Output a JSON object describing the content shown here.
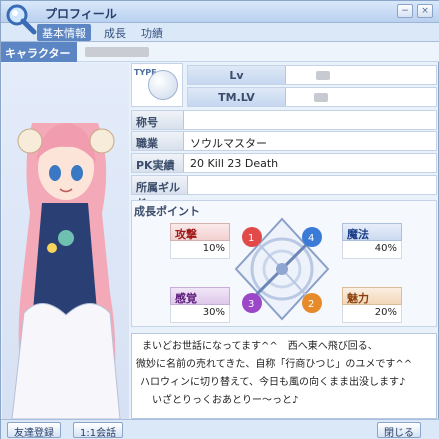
{
  "window": {
    "title": "プロフィール",
    "min_label": "−",
    "close_label": "×"
  },
  "tabs": [
    {
      "label": "基本情報",
      "active": true
    },
    {
      "label": "成長",
      "active": false
    },
    {
      "label": "功績",
      "active": false
    }
  ],
  "character": {
    "name_label": "キャラクター名"
  },
  "type": {
    "label": "TYPE"
  },
  "level": {
    "lv_label": "Lv",
    "tmlv_label": "TM.LV"
  },
  "fields": {
    "title_label": "称号",
    "job_label": "職業",
    "job_value": "ソウルマスター",
    "pk_label": "PK実績",
    "pk_value": "20 Kill  23 Death",
    "guild_label": "所属ギルド"
  },
  "growth": {
    "title": "成長ポイント",
    "stats": [
      {
        "name": "攻撃",
        "value": "10%",
        "marker": "1"
      },
      {
        "name": "魔法",
        "value": "40%",
        "marker": "4"
      },
      {
        "name": "感覚",
        "value": "30%",
        "marker": "3"
      },
      {
        "name": "魅力",
        "value": "20%",
        "marker": "2"
      }
    ]
  },
  "comment": {
    "lines": [
      "まいどお世話になってます^^　西へ東へ飛び回る、",
      "微妙に名前の売れてきた、自称「行商ひつじ」のユメです^^",
      "ハロウィンに切り替えて、今日も風の向くまま出没します♪",
      "いざとりっくおあとりー～っと♪"
    ]
  },
  "buttons": {
    "friend": "友達登録",
    "chat": "1:1会話",
    "close": "閉じる"
  },
  "colors": {
    "accent": "#5b86c3",
    "window_bg": "#e9f1fb"
  }
}
